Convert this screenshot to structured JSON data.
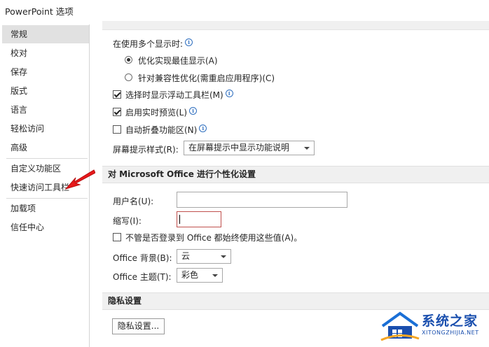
{
  "window": {
    "title": "PowerPoint 选项"
  },
  "sidebar": {
    "items": [
      {
        "label": "常规",
        "selected": true
      },
      {
        "label": "校对"
      },
      {
        "label": "保存"
      },
      {
        "label": "版式"
      },
      {
        "label": "语言"
      },
      {
        "label": "轻松访问"
      },
      {
        "label": "高级"
      },
      {
        "label": "自定义功能区"
      },
      {
        "label": "快速访问工具栏"
      },
      {
        "label": "加载项"
      },
      {
        "label": "信任中心"
      }
    ]
  },
  "display": {
    "multi_monitor_label": "在使用多个显示时:",
    "radio_optimize": "优化实现最佳显示(A)",
    "radio_compat": "针对兼容性优化(需重启应用程序)(C)",
    "cb_minitoolbar": "选择时显示浮动工具栏(M)",
    "cb_livepreview": "启用实时预览(L)",
    "cb_collapse": "自动折叠功能区(N)",
    "screentip_label": "屏幕提示样式(R):",
    "screentip_value": "在屏幕提示中显示功能说明"
  },
  "personalize": {
    "section_title": "对 Microsoft Office 进行个性化设置",
    "username_label": "用户名(U):",
    "username_value": "",
    "initials_label": "缩写(I):",
    "initials_value": "",
    "always_use_label": "不管是否登录到 Office 都始终使用这些值(A)。",
    "bg_label": "Office 背景(B):",
    "bg_value": "云",
    "theme_label": "Office 主题(T):",
    "theme_value": "彩色"
  },
  "privacy": {
    "section_title": "隐私设置",
    "button_label": "隐私设置..."
  },
  "watermark": {
    "name": "系统之家",
    "url": "XITONGZHIJIA.NET"
  },
  "colors": {
    "selected_bg": "#e1e1e1",
    "section_bg": "#f0f0f0",
    "focus_border": "#c0504d",
    "pointer_arrow": "#e8191b",
    "info_icon": "#2f6fbf"
  }
}
